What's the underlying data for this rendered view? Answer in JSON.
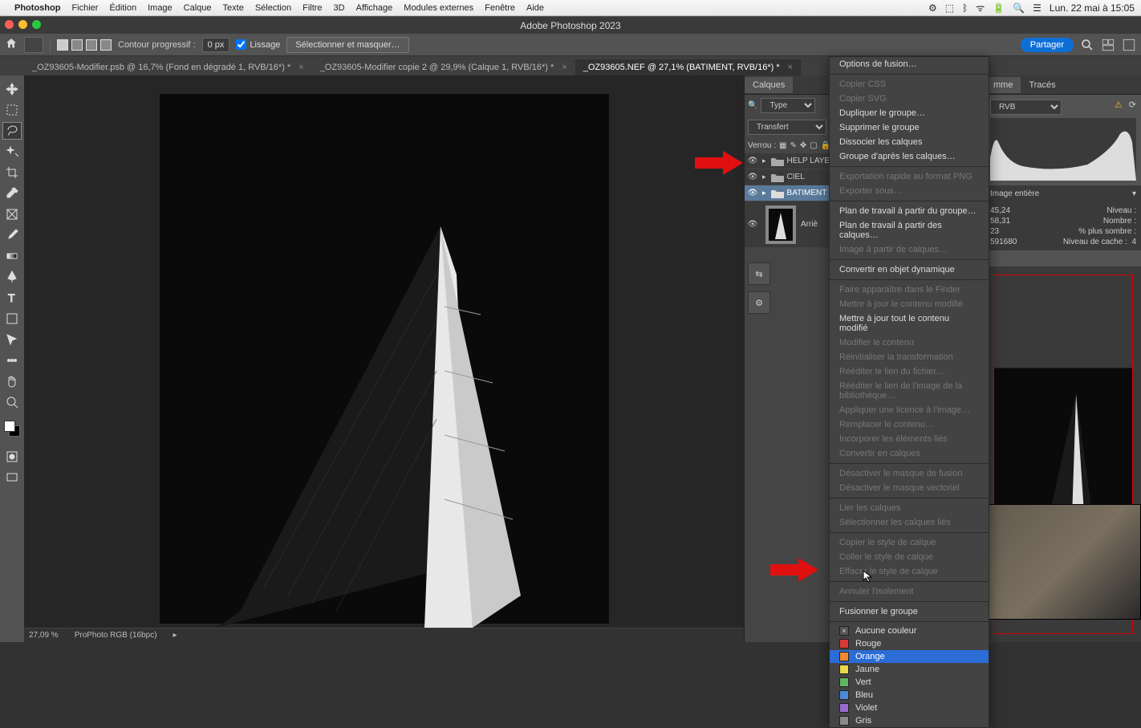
{
  "menubar": {
    "app": "Photoshop",
    "items": [
      "Fichier",
      "Édition",
      "Image",
      "Calque",
      "Texte",
      "Sélection",
      "Filtre",
      "3D",
      "Affichage",
      "Modules externes",
      "Fenêtre",
      "Aide"
    ],
    "clock": "Lun. 22 mai à 15:05"
  },
  "window": {
    "title": "Adobe Photoshop 2023"
  },
  "optionsbar": {
    "feather_label": "Contour progressif :",
    "feather_value": "0 px",
    "antialias": "Lissage",
    "select_mask": "Sélectionner et masquer…",
    "share": "Partager"
  },
  "tabs": [
    {
      "label": "_OZ93605-Modifier.psb @ 16,7% (Fond en dégradé 1, RVB/16*) *",
      "active": false
    },
    {
      "label": "_OZ93605-Modifier copie 2 @ 29,9% (Calque 1, RVB/16*) *",
      "active": false
    },
    {
      "label": "_OZ93605.NEF @ 27,1% (BATIMENT, RVB/16*) *",
      "active": true
    }
  ],
  "panels": {
    "layers_tab": "Calques",
    "histogram_tab": "mme",
    "traces_tab": "Tracés"
  },
  "layers": {
    "kind_label": "Type",
    "blend_mode": "Transfert",
    "lock_label": "Verrou :",
    "items": [
      {
        "name": "HELP LAYERS",
        "type": "folder",
        "visible": true
      },
      {
        "name": "CIEL",
        "type": "folder",
        "visible": true
      },
      {
        "name": "BATIMENT",
        "type": "folder",
        "visible": true,
        "selected": true
      },
      {
        "name": "Arriè",
        "type": "bg",
        "visible": true
      }
    ]
  },
  "histogram": {
    "channel": "RVB",
    "source_label": "Image entière",
    "stats": {
      "mean": "45,24",
      "mean_label": "Niveau :",
      "stddev": "58,31",
      "stddev_label": "Nombre :",
      "median": "23",
      "median_label": "% plus sombre :",
      "pixels": "591680",
      "pixels_label": "Niveau de cache :",
      "cache_level": "4"
    }
  },
  "context_menu": {
    "groups": [
      [
        {
          "label": "Options de fusion…",
          "enabled": true
        }
      ],
      [
        {
          "label": "Copier CSS",
          "enabled": false
        },
        {
          "label": "Copier SVG",
          "enabled": false
        },
        {
          "label": "Dupliquer le groupe…",
          "enabled": true
        },
        {
          "label": "Supprimer le groupe",
          "enabled": true
        },
        {
          "label": "Dissocier les calques",
          "enabled": true
        },
        {
          "label": "Groupe d'après les calques…",
          "enabled": true
        }
      ],
      [
        {
          "label": "Exportation rapide au format PNG",
          "enabled": false
        },
        {
          "label": "Exporter sous…",
          "enabled": false
        }
      ],
      [
        {
          "label": "Plan de travail à partir du groupe…",
          "enabled": true
        },
        {
          "label": "Plan de travail à partir des calques…",
          "enabled": true
        },
        {
          "label": "Image à partir de calques…",
          "enabled": false
        }
      ],
      [
        {
          "label": "Convertir en objet dynamique",
          "enabled": true
        }
      ],
      [
        {
          "label": "Faire apparaître dans le Finder",
          "enabled": false
        },
        {
          "label": "Mettre à jour le contenu modifié",
          "enabled": false
        },
        {
          "label": "Mettre à jour tout le contenu modifié",
          "enabled": true
        },
        {
          "label": "Modifier le contenu",
          "enabled": false
        },
        {
          "label": "Réinitialiser la transformation",
          "enabled": false
        },
        {
          "label": "Rééditer le lien du fichier…",
          "enabled": false
        },
        {
          "label": "Rééditer le lien de l'image de la bibliothèque…",
          "enabled": false
        },
        {
          "label": "Appliquer une licence à l'image…",
          "enabled": false
        },
        {
          "label": "Remplacer le contenu…",
          "enabled": false
        },
        {
          "label": "Incorporer les éléments liés",
          "enabled": false
        },
        {
          "label": "Convertir en calques",
          "enabled": false
        }
      ],
      [
        {
          "label": "Désactiver le masque de fusion",
          "enabled": false
        },
        {
          "label": "Désactiver le masque vectoriel",
          "enabled": false
        }
      ],
      [
        {
          "label": "Lier les calques",
          "enabled": false
        },
        {
          "label": "Sélectionner les calques liés",
          "enabled": false
        }
      ],
      [
        {
          "label": "Copier le style de calque",
          "enabled": false
        },
        {
          "label": "Coller le style de calque",
          "enabled": false
        },
        {
          "label": "Effacer le style de calque",
          "enabled": false
        }
      ],
      [
        {
          "label": "Annuler l'isolement",
          "enabled": false
        }
      ],
      [
        {
          "label": "Fusionner le groupe",
          "enabled": true
        }
      ]
    ],
    "colors": [
      {
        "label": "Aucune couleur",
        "swatch": "transparent"
      },
      {
        "label": "Rouge",
        "swatch": "#d83a32"
      },
      {
        "label": "Orange",
        "swatch": "#f08a2e",
        "selected": true
      },
      {
        "label": "Jaune",
        "swatch": "#e8d84a"
      },
      {
        "label": "Vert",
        "swatch": "#5fb85f"
      },
      {
        "label": "Bleu",
        "swatch": "#4a8ad8"
      },
      {
        "label": "Violet",
        "swatch": "#9a6ad0"
      },
      {
        "label": "Gris",
        "swatch": "#8a8a8a"
      }
    ]
  },
  "footer": {
    "zoom": "27,09 %",
    "profile": "ProPhoto RGB (16bpc)"
  }
}
